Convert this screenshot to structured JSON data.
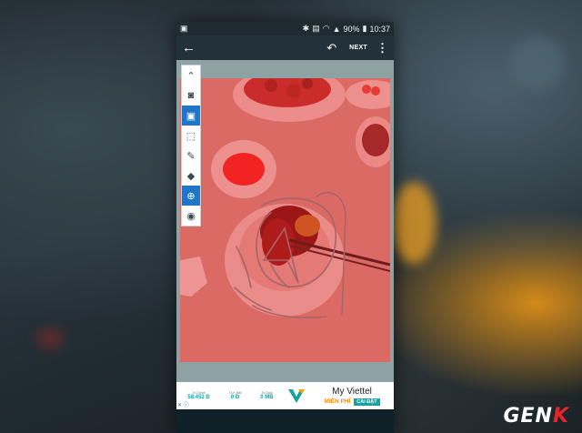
{
  "status_bar": {
    "battery": "90%",
    "time": "10:37"
  },
  "app_bar": {
    "back_icon": "arrow-left-icon",
    "undo_icon": "undo-icon",
    "next_label": "NEXT",
    "more_icon": "more-vert-icon"
  },
  "toolbar": {
    "tools": [
      {
        "name": "collapse",
        "glyph": "⌃",
        "active": false
      },
      {
        "name": "select-subject",
        "glyph": "◙",
        "active": false
      },
      {
        "name": "select-person",
        "glyph": "▣",
        "active": true
      },
      {
        "name": "crop-select",
        "glyph": "⬚",
        "active": false
      },
      {
        "name": "pencil",
        "glyph": "✎",
        "active": false
      },
      {
        "name": "eraser",
        "glyph": "◆",
        "active": false
      },
      {
        "name": "add",
        "glyph": "⊕",
        "active": true
      },
      {
        "name": "preview",
        "glyph": "◉",
        "active": false
      }
    ]
  },
  "ad": {
    "stats": [
      {
        "label": "Tk Chính",
        "value": "58.452 Đ"
      },
      {
        "label": "Tk K.Mãi",
        "value": "0 Đ"
      },
      {
        "label": "Tk Data",
        "value": "0 MB"
      }
    ],
    "title": "My Viettel",
    "free_label": "MIỄN PHÍ",
    "install_label": "CÀI ĐẶT",
    "close_glyph": "✕ ⓘ"
  },
  "watermark": {
    "text_main": "GEN",
    "text_accent": "K"
  },
  "colors": {
    "accent_blue": "#1f76c6",
    "overlay_red": "#e12828",
    "scribble": "#7f8f96"
  }
}
